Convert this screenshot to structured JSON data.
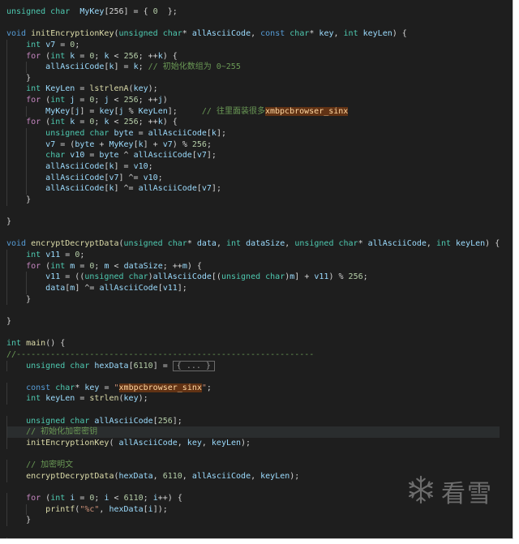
{
  "editor": {
    "lines": [
      [
        [
          "ty",
          "unsigned char"
        ],
        [
          "",
          "  "
        ],
        [
          "vr",
          "MyKey"
        ],
        [
          "",
          "[256] = { "
        ],
        [
          "nm",
          "0"
        ],
        [
          "",
          "  };"
        ]
      ],
      [],
      [
        [
          "kw",
          "void"
        ],
        [
          "",
          " "
        ],
        [
          "fn",
          "initEncryptionKey"
        ],
        [
          "",
          "("
        ],
        [
          "ty",
          "unsigned char"
        ],
        [
          "",
          "* "
        ],
        [
          "vr",
          "allAsciiCode"
        ],
        [
          "",
          ", "
        ],
        [
          "kw",
          "const"
        ],
        [
          "",
          " "
        ],
        [
          "ty",
          "char"
        ],
        [
          "",
          "* "
        ],
        [
          "vr",
          "key"
        ],
        [
          "",
          ", "
        ],
        [
          "ty",
          "int"
        ],
        [
          "",
          " "
        ],
        [
          "vr",
          "keyLen"
        ],
        [
          "",
          ") {"
        ]
      ],
      [
        [
          "",
          "    "
        ],
        [
          "ty",
          "int"
        ],
        [
          "",
          " "
        ],
        [
          "vr",
          "v7"
        ],
        [
          "",
          " = "
        ],
        [
          "nm",
          "0"
        ],
        [
          "",
          ";"
        ]
      ],
      [
        [
          "",
          "    "
        ],
        [
          "ctl",
          "for"
        ],
        [
          "",
          " ("
        ],
        [
          "ty",
          "int"
        ],
        [
          "",
          " "
        ],
        [
          "vr",
          "k"
        ],
        [
          "",
          " = "
        ],
        [
          "nm",
          "0"
        ],
        [
          "",
          "; "
        ],
        [
          "vr",
          "k"
        ],
        [
          "",
          " < "
        ],
        [
          "nm",
          "256"
        ],
        [
          "",
          "; ++"
        ],
        [
          "vr",
          "k"
        ],
        [
          "",
          ") {"
        ]
      ],
      [
        [
          "",
          "        "
        ],
        [
          "vr",
          "allAsciiCode"
        ],
        [
          "",
          "["
        ],
        [
          "vr",
          "k"
        ],
        [
          "",
          "] = "
        ],
        [
          "vr",
          "k"
        ],
        [
          "",
          "; "
        ],
        [
          "cm",
          "// 初始化数组为 0~255"
        ]
      ],
      [
        [
          "",
          "    }"
        ]
      ],
      [
        [
          "",
          "    "
        ],
        [
          "ty",
          "int"
        ],
        [
          "",
          " "
        ],
        [
          "vr",
          "KeyLen"
        ],
        [
          "",
          " = "
        ],
        [
          "fn",
          "lstrlenA"
        ],
        [
          "",
          "("
        ],
        [
          "vr",
          "key"
        ],
        [
          "",
          ");"
        ]
      ],
      [
        [
          "",
          "    "
        ],
        [
          "ctl",
          "for"
        ],
        [
          "",
          " ("
        ],
        [
          "ty",
          "int"
        ],
        [
          "",
          " "
        ],
        [
          "vr",
          "j"
        ],
        [
          "",
          " = "
        ],
        [
          "nm",
          "0"
        ],
        [
          "",
          "; "
        ],
        [
          "vr",
          "j"
        ],
        [
          "",
          " < "
        ],
        [
          "nm",
          "256"
        ],
        [
          "",
          "; ++"
        ],
        [
          "vr",
          "j"
        ],
        [
          "",
          ")"
        ]
      ],
      [
        [
          "",
          "        "
        ],
        [
          "vr",
          "MyKey"
        ],
        [
          "",
          "["
        ],
        [
          "vr",
          "j"
        ],
        [
          "",
          "] = "
        ],
        [
          "vr",
          "key"
        ],
        [
          "",
          "["
        ],
        [
          "vr",
          "j"
        ],
        [
          "",
          " % "
        ],
        [
          "vr",
          "KeyLen"
        ],
        [
          "",
          "];     "
        ],
        [
          "cm",
          "// 往里面装很多"
        ],
        [
          "mark",
          "xmbpcbrowser_sinx"
        ]
      ],
      [
        [
          "",
          "    "
        ],
        [
          "ctl",
          "for"
        ],
        [
          "",
          " ("
        ],
        [
          "ty",
          "int"
        ],
        [
          "",
          " "
        ],
        [
          "vr",
          "k"
        ],
        [
          "",
          " = "
        ],
        [
          "nm",
          "0"
        ],
        [
          "",
          "; "
        ],
        [
          "vr",
          "k"
        ],
        [
          "",
          " < "
        ],
        [
          "nm",
          "256"
        ],
        [
          "",
          "; ++"
        ],
        [
          "vr",
          "k"
        ],
        [
          "",
          ") {"
        ]
      ],
      [
        [
          "",
          "        "
        ],
        [
          "ty",
          "unsigned char"
        ],
        [
          "",
          " "
        ],
        [
          "vr",
          "byte"
        ],
        [
          "",
          " = "
        ],
        [
          "vr",
          "allAsciiCode"
        ],
        [
          "",
          "["
        ],
        [
          "vr",
          "k"
        ],
        [
          "",
          "];"
        ]
      ],
      [
        [
          "",
          "        "
        ],
        [
          "vr",
          "v7"
        ],
        [
          "",
          " = ("
        ],
        [
          "vr",
          "byte"
        ],
        [
          "",
          " + "
        ],
        [
          "vr",
          "MyKey"
        ],
        [
          "",
          "["
        ],
        [
          "vr",
          "k"
        ],
        [
          "",
          "] + "
        ],
        [
          "vr",
          "v7"
        ],
        [
          "",
          ") % "
        ],
        [
          "nm",
          "256"
        ],
        [
          "",
          ";"
        ]
      ],
      [
        [
          "",
          "        "
        ],
        [
          "ty",
          "char"
        ],
        [
          "",
          " "
        ],
        [
          "vr",
          "v10"
        ],
        [
          "",
          " = "
        ],
        [
          "vr",
          "byte"
        ],
        [
          "",
          " ^ "
        ],
        [
          "vr",
          "allAsciiCode"
        ],
        [
          "",
          "["
        ],
        [
          "vr",
          "v7"
        ],
        [
          "",
          "];"
        ]
      ],
      [
        [
          "",
          "        "
        ],
        [
          "vr",
          "allAsciiCode"
        ],
        [
          "",
          "["
        ],
        [
          "vr",
          "k"
        ],
        [
          "",
          "] = "
        ],
        [
          "vr",
          "v10"
        ],
        [
          "",
          ";"
        ]
      ],
      [
        [
          "",
          "        "
        ],
        [
          "vr",
          "allAsciiCode"
        ],
        [
          "",
          "["
        ],
        [
          "vr",
          "v7"
        ],
        [
          "",
          "] ^= "
        ],
        [
          "vr",
          "v10"
        ],
        [
          "",
          ";"
        ]
      ],
      [
        [
          "",
          "        "
        ],
        [
          "vr",
          "allAsciiCode"
        ],
        [
          "",
          "["
        ],
        [
          "vr",
          "k"
        ],
        [
          "",
          "] ^= "
        ],
        [
          "vr",
          "allAsciiCode"
        ],
        [
          "",
          "["
        ],
        [
          "vr",
          "v7"
        ],
        [
          "",
          "];"
        ]
      ],
      [
        [
          "",
          "    }"
        ]
      ],
      [],
      [
        [
          "",
          "}"
        ]
      ],
      [],
      [
        [
          "kw",
          "void"
        ],
        [
          "",
          " "
        ],
        [
          "fn",
          "encryptDecryptData"
        ],
        [
          "",
          "("
        ],
        [
          "ty",
          "unsigned char"
        ],
        [
          "",
          "* "
        ],
        [
          "vr",
          "data"
        ],
        [
          "",
          ", "
        ],
        [
          "ty",
          "int"
        ],
        [
          "",
          " "
        ],
        [
          "vr",
          "dataSize"
        ],
        [
          "",
          ", "
        ],
        [
          "ty",
          "unsigned char"
        ],
        [
          "",
          "* "
        ],
        [
          "vr",
          "allAsciiCode"
        ],
        [
          "",
          ", "
        ],
        [
          "ty",
          "int"
        ],
        [
          "",
          " "
        ],
        [
          "vr",
          "keyLen"
        ],
        [
          "",
          ") {"
        ]
      ],
      [
        [
          "",
          "    "
        ],
        [
          "ty",
          "int"
        ],
        [
          "",
          " "
        ],
        [
          "vr",
          "v11"
        ],
        [
          "",
          " = "
        ],
        [
          "nm",
          "0"
        ],
        [
          "",
          ";"
        ]
      ],
      [
        [
          "",
          "    "
        ],
        [
          "ctl",
          "for"
        ],
        [
          "",
          " ("
        ],
        [
          "ty",
          "int"
        ],
        [
          "",
          " "
        ],
        [
          "vr",
          "m"
        ],
        [
          "",
          " = "
        ],
        [
          "nm",
          "0"
        ],
        [
          "",
          "; "
        ],
        [
          "vr",
          "m"
        ],
        [
          "",
          " < "
        ],
        [
          "vr",
          "dataSize"
        ],
        [
          "",
          "; ++"
        ],
        [
          "vr",
          "m"
        ],
        [
          "",
          ") {"
        ]
      ],
      [
        [
          "",
          "        "
        ],
        [
          "vr",
          "v11"
        ],
        [
          "",
          " = (("
        ],
        [
          "ty",
          "unsigned char"
        ],
        [
          "",
          ")"
        ],
        [
          "vr",
          "allAsciiCode"
        ],
        [
          "",
          "[("
        ],
        [
          "ty",
          "unsigned char"
        ],
        [
          "",
          ")"
        ],
        [
          "vr",
          "m"
        ],
        [
          "",
          "] + "
        ],
        [
          "vr",
          "v11"
        ],
        [
          "",
          ") % "
        ],
        [
          "nm",
          "256"
        ],
        [
          "",
          ";"
        ]
      ],
      [
        [
          "",
          "        "
        ],
        [
          "vr",
          "data"
        ],
        [
          "",
          "["
        ],
        [
          "vr",
          "m"
        ],
        [
          "",
          "] ^= "
        ],
        [
          "vr",
          "allAsciiCode"
        ],
        [
          "",
          "["
        ],
        [
          "vr",
          "v11"
        ],
        [
          "",
          "];"
        ]
      ],
      [
        [
          "",
          "    }"
        ]
      ],
      [],
      [
        [
          "",
          "}"
        ]
      ],
      [],
      [
        [
          "ty",
          "int"
        ],
        [
          "",
          " "
        ],
        [
          "fn",
          "main"
        ],
        [
          "",
          "() {"
        ]
      ],
      [
        [
          "cm",
          "//-------------------------------------------------------------"
        ]
      ],
      [
        [
          "",
          "    "
        ],
        [
          "ty",
          "unsigned char"
        ],
        [
          "",
          " "
        ],
        [
          "vr",
          "hexData"
        ],
        [
          "",
          "["
        ],
        [
          "nm",
          "6110"
        ],
        [
          "",
          "] = "
        ],
        [
          "fold",
          "{ ... }"
        ]
      ],
      [],
      [
        [
          "",
          "    "
        ],
        [
          "kw",
          "const"
        ],
        [
          "",
          " "
        ],
        [
          "ty",
          "char"
        ],
        [
          "",
          "* "
        ],
        [
          "vr",
          "key"
        ],
        [
          "",
          " = "
        ],
        [
          "st",
          "\""
        ],
        [
          "mark",
          "xmbpcbrowser_sinx"
        ],
        [
          "st",
          "\""
        ],
        [
          "",
          ";"
        ]
      ],
      [
        [
          "",
          "    "
        ],
        [
          "ty",
          "int"
        ],
        [
          "",
          " "
        ],
        [
          "vr",
          "keyLen"
        ],
        [
          "",
          " = "
        ],
        [
          "fn",
          "strlen"
        ],
        [
          "",
          "("
        ],
        [
          "vr",
          "key"
        ],
        [
          "",
          ");"
        ]
      ],
      [],
      [
        [
          "",
          "    "
        ],
        [
          "ty",
          "unsigned char"
        ],
        [
          "",
          " "
        ],
        [
          "vr",
          "allAsciiCode"
        ],
        [
          "",
          "["
        ],
        [
          "nm",
          "256"
        ],
        [
          "",
          "];"
        ]
      ],
      [
        [
          "",
          "    "
        ],
        [
          "cm",
          "// 初始化加密密钥"
        ]
      ],
      [
        [
          "",
          "    "
        ],
        [
          "fn",
          "initEncryptionKey"
        ],
        [
          "",
          "( "
        ],
        [
          "vr",
          "allAsciiCode"
        ],
        [
          "",
          ", "
        ],
        [
          "vr",
          "key"
        ],
        [
          "",
          ", "
        ],
        [
          "vr",
          "keyLen"
        ],
        [
          "",
          ");"
        ]
      ],
      [],
      [
        [
          "",
          "    "
        ],
        [
          "cm",
          "// 加密明文"
        ]
      ],
      [
        [
          "",
          "    "
        ],
        [
          "fn",
          "encryptDecryptData"
        ],
        [
          "",
          "("
        ],
        [
          "vr",
          "hexData"
        ],
        [
          "",
          ", "
        ],
        [
          "nm",
          "6110"
        ],
        [
          "",
          ", "
        ],
        [
          "vr",
          "allAsciiCode"
        ],
        [
          "",
          ", "
        ],
        [
          "vr",
          "keyLen"
        ],
        [
          "",
          ");"
        ]
      ],
      [],
      [
        [
          "",
          "    "
        ],
        [
          "ctl",
          "for"
        ],
        [
          "",
          " ("
        ],
        [
          "ty",
          "int"
        ],
        [
          "",
          " "
        ],
        [
          "vr",
          "i"
        ],
        [
          "",
          " = "
        ],
        [
          "nm",
          "0"
        ],
        [
          "",
          "; "
        ],
        [
          "vr",
          "i"
        ],
        [
          "",
          " < "
        ],
        [
          "nm",
          "6110"
        ],
        [
          "",
          "; "
        ],
        [
          "vr",
          "i"
        ],
        [
          "",
          "++) {"
        ]
      ],
      [
        [
          "",
          "        "
        ],
        [
          "fn",
          "printf"
        ],
        [
          "",
          "("
        ],
        [
          "st",
          "\"%c\""
        ],
        [
          "",
          ", "
        ],
        [
          "vr",
          "hexData"
        ],
        [
          "",
          "["
        ],
        [
          "vr",
          "i"
        ],
        [
          "",
          "]);"
        ]
      ],
      [
        [
          "",
          "    }"
        ]
      ],
      [],
      [
        [
          "",
          "    "
        ],
        [
          "ctl",
          "return"
        ],
        [
          "",
          " "
        ],
        [
          "nm",
          "0"
        ],
        [
          "",
          ";"
        ]
      ],
      [
        [
          "",
          "}"
        ]
      ]
    ],
    "highlighted_line": 38
  },
  "watermark": {
    "text": "看雪",
    "icon": "snowflake-icon"
  }
}
